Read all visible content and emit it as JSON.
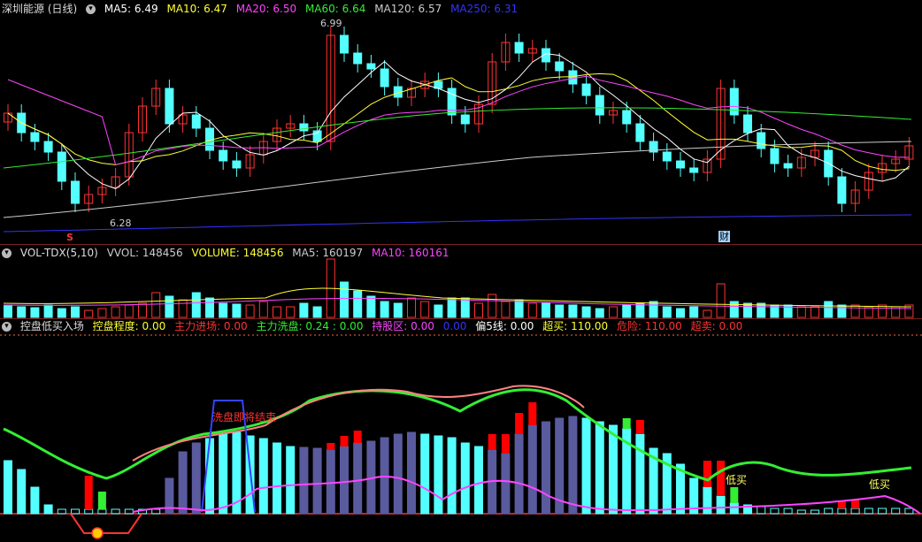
{
  "price_pane": {
    "title": "深圳能源 (日线)",
    "indicators": [
      {
        "label": "MA5: 6.49",
        "color": "#ffffff"
      },
      {
        "label": "MA10: 6.47",
        "color": "#ffff33"
      },
      {
        "label": "MA20: 6.50",
        "color": "#ff44ff"
      },
      {
        "label": "MA60: 6.64",
        "color": "#33ee33"
      },
      {
        "label": "MA120: 6.57",
        "color": "#cccccc"
      },
      {
        "label": "MA250: 6.31",
        "color": "#3333ff"
      }
    ],
    "high_label": "6.99",
    "low_label": "6.28",
    "marker_s": "S",
    "marker_cai": "财"
  },
  "volume_pane": {
    "title": "VOL-TDX(5,10)",
    "indicators": [
      {
        "label": "VVOL: 148456",
        "color": "#cccccc"
      },
      {
        "label": "VOLUME: 148456",
        "color": "#ffff33"
      },
      {
        "label": "MA5: 160197",
        "color": "#cccccc"
      },
      {
        "label": "MA10: 160161",
        "color": "#ff44ff"
      }
    ]
  },
  "indicator_pane": {
    "title": "控盘低买入场",
    "indicators": [
      {
        "label": "控盘程度: 0.00",
        "color": "#ffff33"
      },
      {
        "label": "主力进场: 0.00",
        "color": "#ff3333"
      },
      {
        "label": "主力洗盘: 0.24 : 0.00",
        "color": "#33ee33"
      },
      {
        "label": "持股区: 0.00",
        "color": "#ff44ff"
      },
      {
        "label": "0.00",
        "color": "#3333ff"
      },
      {
        "label": "偏5线: 0.00",
        "color": "#ffffff"
      },
      {
        "label": "超买: 110.00",
        "color": "#ffff33"
      },
      {
        "label": "危险: 110.00",
        "color": "#ff3333"
      },
      {
        "label": "超卖: 0.00",
        "color": "#ff3333"
      }
    ],
    "annotation_wash": "洗盘即将结束",
    "annotation_buy1": "低买",
    "annotation_buy2": "低买"
  },
  "colors": {
    "up": "#ff3333",
    "down": "#54ffff",
    "bg": "#000000",
    "separator": "#7a1f1f"
  }
}
